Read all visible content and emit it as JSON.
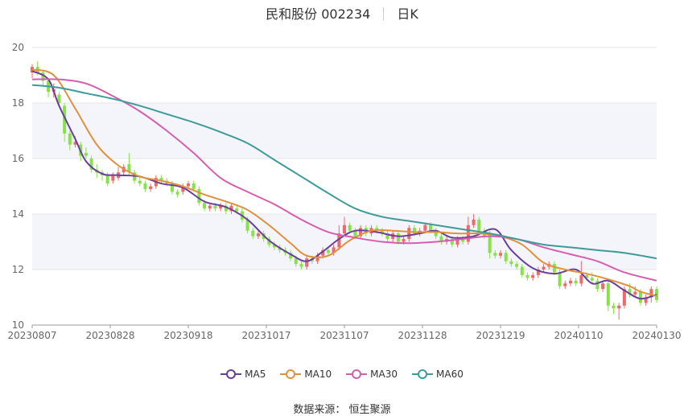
{
  "header": {
    "title": "民和股份 002234",
    "tab": "日K"
  },
  "source_text": "数据来源： 恒生聚源",
  "chart_data": {
    "type": "candlestick",
    "title": "民和股份 002234",
    "period": "日K",
    "ylim": [
      10,
      20
    ],
    "yticks": [
      10,
      12,
      14,
      16,
      18,
      20
    ],
    "x_tick_labels": [
      "20230807",
      "20230828",
      "20230918",
      "20231017",
      "20231107",
      "20231128",
      "20231219",
      "20240110",
      "20240130"
    ],
    "trading_days": 117,
    "legend": [
      "MA5",
      "MA10",
      "MA30",
      "MA60"
    ],
    "colors": {
      "up": "#ee6a6a",
      "down": "#8ae04a",
      "MA5": "#6a3e9c",
      "MA10": "#e0913e",
      "MA30": "#d45fae",
      "MA60": "#3f9a9a",
      "band": "#f3f5fb",
      "grid": "#e6e6e6"
    },
    "candles": [
      [
        19.1,
        19.3,
        19.4,
        18.9
      ],
      [
        19.3,
        19.1,
        19.5,
        19.0
      ],
      [
        19.1,
        18.8,
        19.2,
        18.6
      ],
      [
        18.8,
        18.4,
        18.9,
        18.2
      ],
      [
        18.4,
        18.5,
        18.7,
        18.2
      ],
      [
        18.3,
        18.0,
        18.4,
        17.9
      ],
      [
        17.9,
        16.9,
        18.0,
        16.6
      ],
      [
        16.9,
        16.5,
        17.0,
        16.3
      ],
      [
        16.5,
        16.6,
        16.8,
        16.4
      ],
      [
        16.5,
        16.1,
        16.6,
        15.9
      ],
      [
        16.2,
        16.1,
        16.4,
        16.0
      ],
      [
        16.0,
        15.6,
        16.1,
        15.5
      ],
      [
        15.6,
        15.5,
        15.8,
        15.3
      ],
      [
        15.5,
        15.4,
        15.6,
        15.2
      ],
      [
        15.4,
        15.1,
        15.5,
        15.0
      ],
      [
        15.2,
        15.4,
        15.5,
        15.1
      ],
      [
        15.3,
        15.5,
        15.7,
        15.2
      ],
      [
        15.5,
        15.7,
        15.8,
        15.4
      ],
      [
        15.8,
        15.5,
        16.2,
        15.4
      ],
      [
        15.5,
        15.2,
        15.6,
        15.1
      ],
      [
        15.2,
        15.1,
        15.4,
        15.0
      ],
      [
        15.1,
        14.9,
        15.2,
        14.8
      ],
      [
        14.9,
        15.0,
        15.1,
        14.8
      ],
      [
        15.0,
        15.3,
        15.4,
        14.9
      ],
      [
        15.3,
        15.2,
        15.4,
        15.1
      ],
      [
        15.2,
        15.1,
        15.3,
        15.0
      ],
      [
        15.1,
        14.8,
        15.2,
        14.7
      ],
      [
        14.8,
        14.7,
        14.9,
        14.6
      ],
      [
        14.8,
        15.0,
        15.1,
        14.7
      ],
      [
        15.0,
        15.1,
        15.2,
        14.9
      ],
      [
        15.1,
        14.9,
        15.2,
        14.8
      ],
      [
        14.9,
        14.4,
        15.0,
        14.3
      ],
      [
        14.4,
        14.2,
        14.5,
        14.1
      ],
      [
        14.2,
        14.3,
        14.4,
        14.1
      ],
      [
        14.3,
        14.2,
        14.4,
        14.1
      ],
      [
        14.2,
        14.3,
        14.4,
        14.1
      ],
      [
        14.3,
        14.1,
        14.4,
        14.0
      ],
      [
        14.1,
        14.3,
        14.4,
        14.0
      ],
      [
        14.2,
        14.1,
        14.3,
        14.0
      ],
      [
        14.1,
        13.8,
        14.2,
        13.7
      ],
      [
        13.8,
        13.4,
        13.9,
        13.3
      ],
      [
        13.4,
        13.2,
        13.5,
        13.1
      ],
      [
        13.2,
        13.3,
        13.4,
        13.1
      ],
      [
        13.3,
        13.1,
        13.4,
        13.0
      ],
      [
        13.1,
        12.9,
        13.2,
        12.8
      ],
      [
        12.9,
        12.8,
        13.0,
        12.7
      ],
      [
        12.8,
        12.7,
        12.9,
        12.6
      ],
      [
        12.7,
        12.6,
        12.8,
        12.5
      ],
      [
        12.6,
        12.4,
        12.7,
        12.3
      ],
      [
        12.4,
        12.2,
        12.5,
        12.1
      ],
      [
        12.2,
        12.1,
        12.3,
        12.0
      ],
      [
        12.1,
        12.4,
        12.5,
        12.0
      ],
      [
        12.4,
        12.3,
        12.5,
        12.2
      ],
      [
        12.3,
        12.5,
        12.6,
        12.2
      ],
      [
        12.5,
        12.7,
        12.8,
        12.4
      ],
      [
        12.7,
        12.6,
        12.8,
        12.5
      ],
      [
        12.6,
        12.8,
        12.9,
        12.5
      ],
      [
        12.8,
        13.3,
        13.6,
        12.7
      ],
      [
        13.3,
        13.6,
        13.9,
        13.2
      ],
      [
        13.6,
        13.4,
        13.7,
        13.3
      ],
      [
        13.4,
        13.2,
        13.5,
        13.1
      ],
      [
        13.2,
        13.5,
        13.6,
        13.1
      ],
      [
        13.5,
        13.3,
        13.6,
        13.2
      ],
      [
        13.3,
        13.5,
        13.6,
        13.2
      ],
      [
        13.5,
        13.4,
        13.6,
        13.3
      ],
      [
        13.4,
        13.3,
        13.5,
        13.2
      ],
      [
        13.3,
        13.1,
        13.4,
        13.0
      ],
      [
        13.1,
        13.3,
        13.4,
        13.0
      ],
      [
        13.3,
        13.0,
        13.4,
        12.9
      ],
      [
        13.0,
        13.1,
        13.2,
        12.9
      ],
      [
        13.1,
        13.5,
        13.6,
        13.0
      ],
      [
        13.5,
        13.3,
        13.6,
        13.2
      ],
      [
        13.3,
        13.4,
        13.5,
        13.2
      ],
      [
        13.4,
        13.6,
        13.7,
        13.3
      ],
      [
        13.6,
        13.4,
        13.7,
        13.3
      ],
      [
        13.4,
        13.2,
        13.5,
        13.1
      ],
      [
        13.2,
        13.0,
        13.3,
        12.9
      ],
      [
        13.0,
        13.1,
        13.2,
        12.9
      ],
      [
        13.1,
        12.9,
        13.2,
        12.8
      ],
      [
        12.9,
        13.1,
        13.2,
        12.8
      ],
      [
        13.1,
        13.0,
        13.2,
        12.9
      ],
      [
        13.0,
        13.6,
        13.9,
        12.9
      ],
      [
        13.6,
        13.8,
        14.0,
        13.5
      ],
      [
        13.8,
        13.4,
        13.9,
        13.3
      ],
      [
        13.4,
        13.2,
        13.5,
        13.1
      ],
      [
        13.3,
        12.6,
        13.4,
        12.4
      ],
      [
        12.6,
        12.5,
        12.7,
        12.4
      ],
      [
        12.5,
        12.6,
        12.7,
        12.4
      ],
      [
        12.6,
        12.3,
        12.7,
        12.2
      ],
      [
        12.3,
        12.2,
        12.4,
        12.1
      ],
      [
        12.2,
        12.1,
        12.3,
        12.0
      ],
      [
        12.1,
        11.8,
        12.2,
        11.7
      ],
      [
        11.8,
        11.7,
        11.9,
        11.6
      ],
      [
        11.7,
        11.8,
        11.9,
        11.6
      ],
      [
        11.8,
        12.0,
        12.1,
        11.7
      ],
      [
        12.0,
        12.1,
        12.2,
        11.9
      ],
      [
        12.1,
        12.2,
        12.3,
        12.0
      ],
      [
        12.2,
        11.9,
        12.3,
        11.8
      ],
      [
        11.9,
        11.4,
        12.0,
        11.3
      ],
      [
        11.4,
        11.5,
        11.6,
        11.3
      ],
      [
        11.5,
        11.6,
        11.7,
        11.4
      ],
      [
        11.6,
        11.5,
        11.7,
        11.4
      ],
      [
        11.5,
        11.8,
        12.3,
        11.4
      ],
      [
        11.8,
        11.7,
        11.9,
        11.6
      ],
      [
        11.7,
        11.6,
        11.9,
        11.5
      ],
      [
        11.6,
        11.3,
        11.7,
        11.2
      ],
      [
        11.3,
        11.5,
        11.6,
        11.2
      ],
      [
        11.5,
        10.7,
        11.6,
        10.5
      ],
      [
        10.7,
        10.6,
        10.8,
        10.4
      ],
      [
        10.6,
        10.7,
        10.8,
        10.2
      ],
      [
        10.7,
        11.3,
        11.4,
        10.6
      ],
      [
        11.3,
        11.1,
        11.5,
        11.0
      ],
      [
        11.1,
        11.2,
        11.4,
        11.0
      ],
      [
        11.2,
        10.8,
        11.3,
        10.7
      ],
      [
        10.8,
        11.0,
        11.1,
        10.7
      ],
      [
        11.0,
        11.3,
        11.4,
        10.8
      ],
      [
        11.3,
        10.9,
        11.4,
        10.8
      ]
    ],
    "series": [
      {
        "name": "MA5",
        "x": [
          0,
          3,
          5,
          8,
          10,
          13,
          16,
          20,
          24,
          28,
          32,
          36,
          40,
          44,
          48,
          51,
          54,
          57,
          60,
          64,
          68,
          72,
          75,
          78,
          82,
          86,
          89,
          93,
          97,
          101,
          104,
          107,
          110,
          113,
          116
        ],
        "values": [
          19.15,
          18.85,
          17.9,
          16.7,
          15.9,
          15.45,
          15.4,
          15.35,
          15.1,
          14.95,
          14.45,
          14.25,
          13.8,
          13.05,
          12.55,
          12.3,
          12.65,
          13.1,
          13.4,
          13.35,
          13.2,
          13.3,
          13.4,
          13.15,
          13.2,
          13.45,
          12.7,
          12.05,
          11.85,
          12.0,
          11.5,
          11.6,
          11.25,
          10.95,
          11.1
        ]
      },
      {
        "name": "MA10",
        "x": [
          0,
          4,
          8,
          12,
          16,
          20,
          24,
          28,
          32,
          36,
          40,
          44,
          48,
          51,
          55,
          59,
          63,
          67,
          71,
          75,
          79,
          83,
          87,
          91,
          95,
          99,
          103,
          107,
          111,
          113,
          116
        ],
        "values": [
          19.2,
          19.0,
          17.8,
          16.5,
          15.75,
          15.35,
          15.2,
          15.0,
          14.7,
          14.45,
          14.15,
          13.6,
          12.95,
          12.5,
          12.5,
          13.05,
          13.4,
          13.4,
          13.35,
          13.35,
          13.3,
          13.3,
          13.2,
          12.9,
          12.25,
          12.0,
          11.85,
          11.65,
          11.4,
          11.2,
          11.05
        ]
      },
      {
        "name": "MA30",
        "x": [
          0,
          5,
          10,
          15,
          20,
          25,
          30,
          35,
          40,
          45,
          50,
          55,
          60,
          65,
          70,
          75,
          80,
          85,
          90,
          95,
          100,
          105,
          110,
          116
        ],
        "values": [
          18.85,
          18.85,
          18.7,
          18.25,
          17.7,
          17.0,
          16.2,
          15.3,
          14.8,
          14.35,
          13.8,
          13.35,
          13.15,
          13.0,
          12.95,
          13.0,
          13.1,
          13.2,
          13.1,
          12.8,
          12.55,
          12.3,
          11.9,
          11.6
        ]
      },
      {
        "name": "MA60",
        "x": [
          0,
          5,
          10,
          15,
          20,
          25,
          30,
          35,
          40,
          45,
          50,
          55,
          60,
          65,
          70,
          75,
          80,
          85,
          90,
          95,
          100,
          105,
          110,
          116
        ],
        "values": [
          18.65,
          18.55,
          18.35,
          18.15,
          17.9,
          17.6,
          17.3,
          16.95,
          16.55,
          15.95,
          15.35,
          14.75,
          14.2,
          13.9,
          13.75,
          13.6,
          13.45,
          13.3,
          13.1,
          12.9,
          12.8,
          12.7,
          12.6,
          12.4
        ]
      }
    ]
  }
}
